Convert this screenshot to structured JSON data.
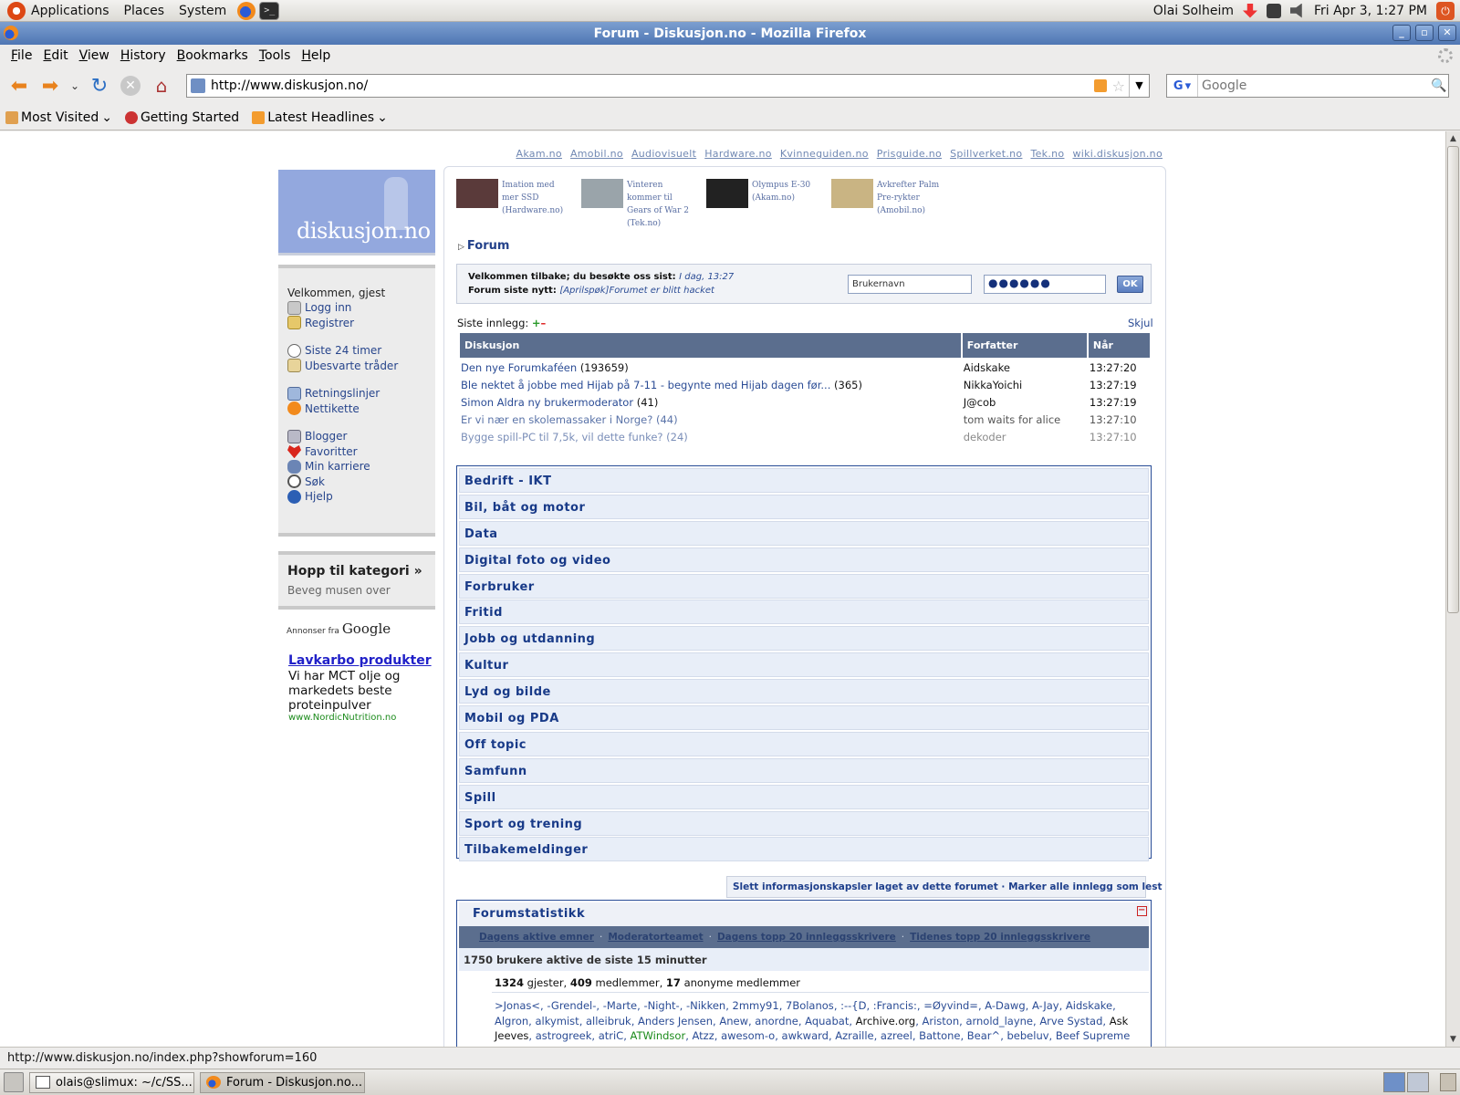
{
  "panel": {
    "menus": [
      "Applications",
      "Places",
      "System"
    ],
    "user": "Olai Solheim",
    "datetime": "Fri Apr  3,  1:27 PM"
  },
  "window": {
    "title": "Forum - Diskusjon.no - Mozilla Firefox"
  },
  "menubar": [
    "File",
    "Edit",
    "View",
    "History",
    "Bookmarks",
    "Tools",
    "Help"
  ],
  "navbar": {
    "url": "http://www.diskusjon.no/",
    "search_placeholder": "Google",
    "search_engine": "G"
  },
  "bookmarks": [
    "Most Visited",
    "Getting Started",
    "Latest Headlines"
  ],
  "page": {
    "site_links": [
      "Akam.no",
      "Amobil.no",
      "Audiovisuelt",
      "Hardware.no",
      "Kvinneguiden.no",
      "Prisguide.no",
      "Spillverket.no",
      "Tek.no",
      "wiki.diskusjon.no"
    ],
    "logo_text": "diskusjon.no",
    "sidebar": {
      "welcome": "Velkommen, gjest",
      "links": [
        {
          "label": "Logg inn",
          "icon": "lock-icon"
        },
        {
          "label": "Registrer",
          "icon": "register-icon"
        },
        {
          "label": "Siste 24 timer",
          "icon": "clock-icon"
        },
        {
          "label": "Ubesvarte tråder",
          "icon": "mail-icon"
        },
        {
          "label": "Retningslinjer",
          "icon": "rules-icon"
        },
        {
          "label": "Nettikette",
          "icon": "warning-icon"
        },
        {
          "label": "Blogger",
          "icon": "blog-icon"
        },
        {
          "label": "Favoritter",
          "icon": "heart-icon"
        },
        {
          "label": "Min karriere",
          "icon": "footprints-icon"
        },
        {
          "label": "Søk",
          "icon": "search-icon"
        },
        {
          "label": "Hjelp",
          "icon": "help-icon"
        }
      ],
      "jump_title": "Hopp til kategori »",
      "jump_sub": "Beveg musen over",
      "ads_by": "Annonser fra",
      "ads_google": "Google",
      "ad": {
        "title": "Lavkarbo produkter",
        "body": "Vi har MCT olje og markedets beste proteinpulver",
        "url": "www.NordicNutrition.no"
      }
    },
    "news": [
      {
        "title": "Imation med mer SSD",
        "source": "(Hardware.no)",
        "thumb_color": "#5a3a3a"
      },
      {
        "title": "Vinteren kommer til Gears of War 2",
        "source": "(Tek.no)",
        "thumb_color": "#9aa4aa"
      },
      {
        "title": "Olympus E-30",
        "source": "(Akam.no)",
        "thumb_color": "#222222"
      },
      {
        "title": "Avkrefter Palm Pre-rykter",
        "source": "(Amobil.no)",
        "thumb_color": "#c9b483"
      }
    ],
    "breadcrumb": "Forum",
    "welcome_bar": {
      "line1": "Velkommen tilbake; du besøkte oss sist:",
      "line1_value": "I dag, 13:27",
      "line2": "Forum siste nytt:",
      "line2_value": "[Aprilspøk]Forumet er blitt hacket",
      "username_placeholder": "Brukernavn",
      "password_mask": "●●●●●●",
      "ok_label": "OK"
    },
    "recent": {
      "label": "Siste innlegg:",
      "hide": "Skjul",
      "headers": [
        "Diskusjon",
        "Forfatter",
        "Når"
      ],
      "rows": [
        {
          "topic": "Den nye Forumkaféen",
          "count": "(193659)",
          "author": "Aidskake",
          "time": "13:27:20"
        },
        {
          "topic": "Ble nektet å jobbe med Hijab på 7-11 - begynte med Hijab dagen før...",
          "count": "(365)",
          "author": "NikkaYoichi",
          "time": "13:27:19"
        },
        {
          "topic": "Simon Aldra ny brukermoderator",
          "count": "(41)",
          "author": "J@cob",
          "time": "13:27:19"
        },
        {
          "topic": "Er vi nær en skolemassaker i Norge?",
          "count": "(44)",
          "author": "tom waits for alice",
          "time": "13:27:10"
        },
        {
          "topic": "Bygge spill-PC til 7,5k, vil dette funke?",
          "count": "(24)",
          "author": "dekoder",
          "time": "13:27:10"
        }
      ]
    },
    "categories": [
      "Bedrift - IKT",
      "Bil, båt og motor",
      "Data",
      "Digital foto og video",
      "Forbruker",
      "Fritid",
      "Jobb og utdanning",
      "Kultur",
      "Lyd og bilde",
      "Mobil og PDA",
      "Off topic",
      "Samfunn",
      "Spill",
      "Sport og trening",
      "Tilbakemeldinger"
    ],
    "clear_bar": "Slett informasjonskapsler laget av dette forumet · Marker alle innlegg som lest",
    "stats": {
      "title": "Forumstatistikk",
      "links": [
        "Dagens aktive emner",
        "Moderatorteamet",
        "Dagens topp 20 innleggsskrivere",
        "Tidenes topp 20 innleggsskrivere"
      ],
      "active": "1750 brukere aktive de siste 15 minutter",
      "guests": "1324",
      "guests_label": " gjester, ",
      "members": "409",
      "members_label": " medlemmer, ",
      "anon": "17",
      "anon_label": " anonyme medlemmer",
      "users": [
        ">Jonas<",
        "-Grendel-",
        "-Marte",
        "-Night-",
        "-Nikken",
        "2mmy91",
        "7Bolanos",
        ":--{D",
        ":Francis:",
        "=Øyvind=",
        "A-Dawg",
        "A-Jay",
        "Aidskake",
        "Algron",
        "alkymist",
        "alleibruk",
        "Anders Jensen",
        "Anew",
        "anordne",
        "Aquabat",
        "Archive.org",
        "Ariston",
        "arnold_layne",
        "Arve Systad",
        "Ask Jeeves",
        "astrogreek",
        "atriC",
        "ATWindsor",
        "Atzz",
        "awesom-o",
        "awkward",
        "Azraille",
        "azreel",
        "Battone",
        "Bear^",
        "bebeluv",
        "Beef Supreme"
      ]
    }
  },
  "statusbar": "http://www.diskusjon.no/index.php?showforum=160",
  "taskbar": [
    "olais@slimux: ~/c/SS...",
    "Forum - Diskusjon.no..."
  ]
}
